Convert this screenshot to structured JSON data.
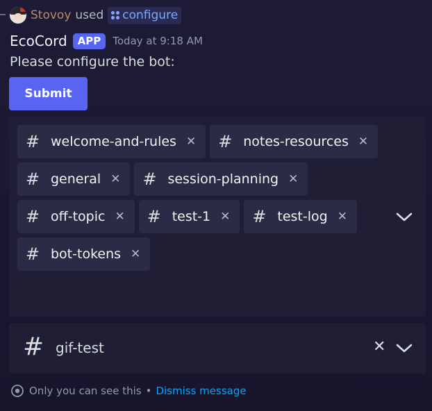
{
  "reply": {
    "user": "Stovoy",
    "used_text": "used",
    "command": "configure"
  },
  "message": {
    "bot_name": "EcoCord",
    "badge": "APP",
    "timestamp": "Today at 9:18 AM",
    "text": "Please configure the bot:",
    "submit_label": "Submit"
  },
  "multi_select": {
    "selected": [
      "welcome-and-rules",
      "notes-resources",
      "general",
      "session-planning",
      "off-topic",
      "test-1",
      "test-log",
      "bot-tokens"
    ],
    "hash_symbol": "#",
    "remove_symbol": "✕"
  },
  "single_select": {
    "hash_symbol": "#",
    "value": "gif-test",
    "clear_symbol": "✕"
  },
  "footer": {
    "notice": "Only you can see this",
    "separator": "•",
    "dismiss_label": "Dismiss message"
  },
  "colors": {
    "accent": "#5865f2",
    "link": "#00a8fc",
    "command": "#7ea8ff",
    "background": "#1d1b36"
  }
}
